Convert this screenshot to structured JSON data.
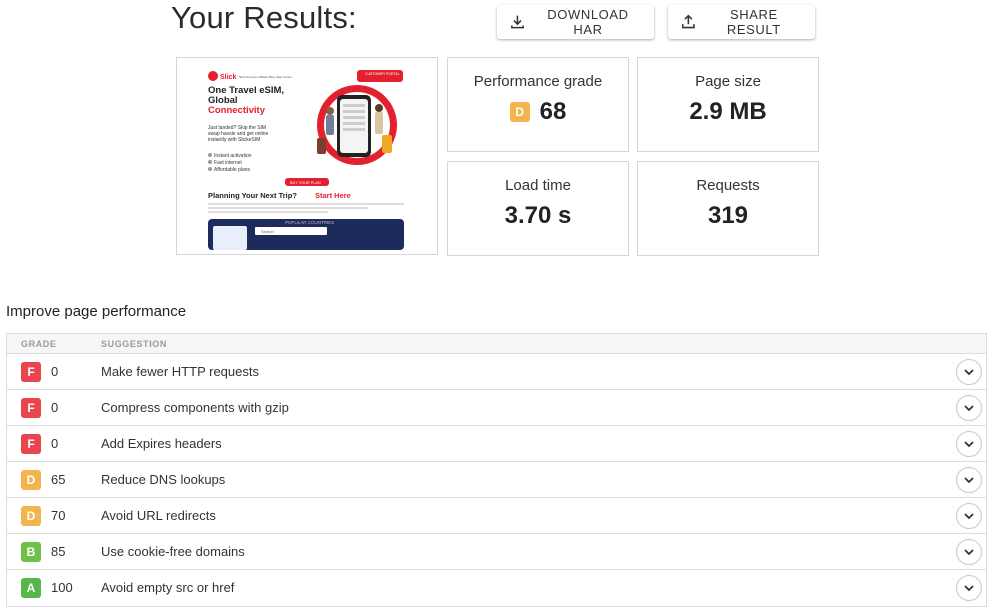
{
  "header": {
    "title": "Your Results:",
    "download_label": "DOWNLOAD HAR",
    "share_label": "SHARE RESULT"
  },
  "preview": {
    "brand": "Slick",
    "nav_text": "Slick Services Affiliate Blog Help Center",
    "cta_top": "CUSTOMER PORTAL",
    "headline_1": "One Travel eSIM,",
    "headline_2": "Global",
    "headline_3": "Connectivity",
    "body_1": "Just landed? Skip the SIM",
    "body_2": "swap hassle and get online",
    "body_3": "instantly with SlickeSIM",
    "features": [
      "Instant activation",
      "Fast internet",
      "Affordable plans"
    ],
    "buy_button": "BUY YOUR PLAN",
    "planning_1": "Planning Your Next Trip?",
    "planning_2": "Start Here",
    "popular": "POPULAR COUNTRIES",
    "search": "Search"
  },
  "metrics": {
    "grade_label": "Performance grade",
    "grade_letter": "D",
    "grade_value": "68",
    "size_label": "Page size",
    "size_value": "2.9 MB",
    "load_label": "Load time",
    "load_value": "3.70 s",
    "req_label": "Requests",
    "req_value": "319"
  },
  "improve": {
    "title": "Improve page performance",
    "col_grade": "GRADE",
    "col_suggestion": "SUGGESTION",
    "rows": [
      {
        "grade": "F",
        "score": "0",
        "suggestion": "Make fewer HTTP requests"
      },
      {
        "grade": "F",
        "score": "0",
        "suggestion": "Compress components with gzip"
      },
      {
        "grade": "F",
        "score": "0",
        "suggestion": "Add Expires headers"
      },
      {
        "grade": "D",
        "score": "65",
        "suggestion": "Reduce DNS lookups"
      },
      {
        "grade": "D",
        "score": "70",
        "suggestion": "Avoid URL redirects"
      },
      {
        "grade": "B",
        "score": "85",
        "suggestion": "Use cookie-free domains"
      },
      {
        "grade": "A",
        "score": "100",
        "suggestion": "Avoid empty src or href"
      }
    ]
  },
  "colors": {
    "grade_F": "#e8454e",
    "grade_D": "#f2b44d",
    "grade_B": "#6fbf48",
    "grade_A": "#57b74a",
    "brand_red": "#e3202e"
  }
}
